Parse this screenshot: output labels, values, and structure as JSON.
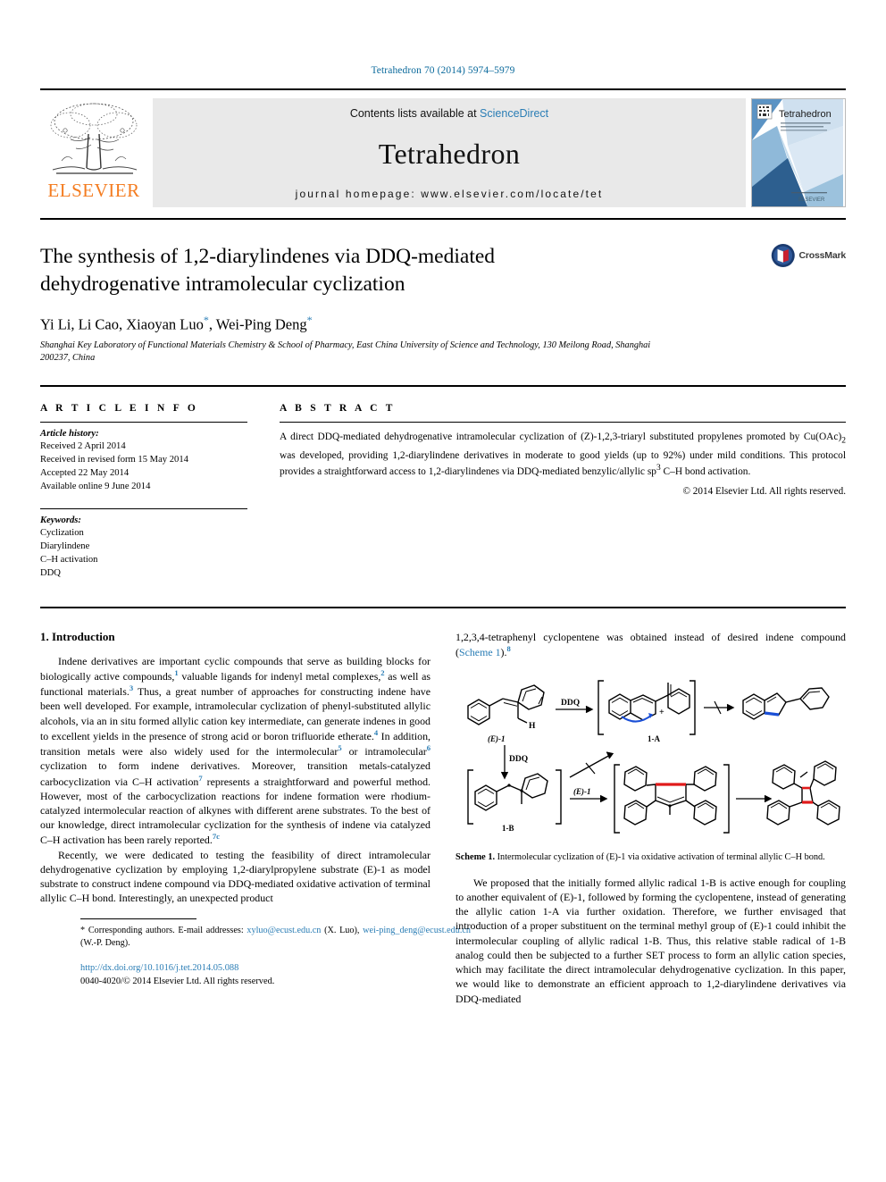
{
  "running_head": "Tetrahedron 70 (2014) 5974–5979",
  "masthead": {
    "contents_prefix": "Contents lists available at ",
    "sciencedirect": "ScienceDirect",
    "journal_name": "Tetrahedron",
    "homepage": "journal homepage: www.elsevier.com/locate/tet",
    "publisher_wordmark": "ELSEVIER",
    "cover_title": "Tetrahedron",
    "link_color": "#2a7db5",
    "elsevier_orange": "#F47C20"
  },
  "article": {
    "title": "The synthesis of 1,2-diarylindenes via DDQ-mediated dehydrogenative intramolecular cyclization",
    "authors": "Yi Li, Li Cao, Xiaoyan Luo",
    "authors_tail": ", Wei-Ping Deng",
    "affiliation": "Shanghai Key Laboratory of Functional Materials Chemistry & School of Pharmacy, East China University of Science and Technology, 130 Meilong Road, Shanghai 200237, China",
    "crossmark_label": "CrossMark"
  },
  "article_info": {
    "heading": "A R T I C L E   I N F O",
    "history_label": "Article history:",
    "history": [
      "Received 2 April 2014",
      "Received in revised form 15 May 2014",
      "Accepted 22 May 2014",
      "Available online 9 June 2014"
    ],
    "keywords_label": "Keywords:",
    "keywords": [
      "Cyclization",
      "Diarylindene",
      "C–H activation",
      "DDQ"
    ]
  },
  "abstract": {
    "heading": "A B S T R A C T",
    "text_part1": "A direct DDQ-mediated dehydrogenative intramolecular cyclization of (Z)-1,2,3-triaryl substituted propylenes promoted by Cu(OAc)",
    "sub1": "2",
    "text_part2": " was developed, providing 1,2-diarylindene derivatives in moderate to good yields (up to 92%) under mild conditions. This protocol provides a straightforward access to 1,2-diarylindenes via DDQ-mediated benzylic/allylic sp",
    "sup1": "3",
    "text_part3": " C–H bond activation.",
    "copyright": "© 2014 Elsevier Ltd. All rights reserved."
  },
  "body": {
    "intro_heading": "1. Introduction",
    "para1_a": "Indene derivatives are important cyclic compounds that serve as building blocks for biologically active compounds,",
    "ref1": "1",
    "para1_b": " valuable ligands for indenyl metal complexes,",
    "ref2": "2",
    "para1_c": " as well as functional materials.",
    "ref3": "3",
    "para1_d": " Thus, a great number of approaches for constructing indene have been well developed. For example, intramolecular cyclization of phenyl-substituted allylic alcohols, via an in situ formed allylic cation key intermediate, can generate indenes in good to excellent yields in the presence of strong acid or boron trifluoride etherate.",
    "ref4": "4",
    "para1_e": " In addition, transition metals were also widely used for the intermolecular",
    "ref5": "5",
    "para1_f": " or intramolecular",
    "ref6": "6",
    "para1_g": " cyclization to form indene derivatives. Moreover, transition metals-catalyzed carbocyclization via C–H activation",
    "ref7": "7",
    "para1_h": " represents a straightforward and powerful method. However, most of the carbocyclization reactions for indene formation were rhodium-catalyzed intermolecular reaction of alkynes with different arene substrates. To the best of our knowledge, direct intramolecular cyclization for the synthesis of indene via catalyzed C–H activation has been rarely reported.",
    "ref7c": "7c",
    "para2_a": "Recently, we were dedicated to testing the feasibility of direct intramolecular dehydrogenative cyclization by employing 1,2-diarylpropylene substrate (E)-1 as model substrate to construct indene compound via DDQ-mediated oxidative activation of terminal allylic C–H bond. Interestingly, an unexpected product",
    "right_lead_a": "1,2,3,4-tetraphenyl cyclopentene was obtained instead of desired indene compound (",
    "scheme_link": "Scheme 1",
    "right_lead_b": ").",
    "ref8": "8",
    "scheme_caption_label": "Scheme 1.",
    "scheme_caption_text": " Intermolecular cyclization of (E)-1 via oxidative activation of terminal allylic C–H bond.",
    "para3": "We proposed that the initially formed allylic radical 1-B is active enough for coupling to another equivalent of (E)-1, followed by forming the cyclopentene, instead of generating the allylic cation 1-A via further oxidation. Therefore, we further envisaged that introduction of a proper substituent on the terminal methyl group of (E)-1 could inhibit the intermolecular coupling of allylic radical 1-B. Thus, this relative stable radical of 1-B analog could then be subjected to a further SET process to form an allylic cation species, which may facilitate the direct intramolecular dehydrogenative cyclization. In this paper, we would like to demonstrate an efficient approach to 1,2-diarylindene derivatives via DDQ-mediated"
  },
  "scheme_labels": {
    "ddq1": "DDQ",
    "ddq2": "DDQ",
    "e1_label_a": "(E)-1",
    "e1_label_b": "(E)-1",
    "h_label": "H",
    "label_1a": "1-A",
    "label_1b": "1-B",
    "plus": "+"
  },
  "footnote": {
    "star": "*",
    "text_a": " Corresponding authors. E-mail addresses: ",
    "email1": "xyluo@ecust.edu.cn",
    "mid1": " (X. Luo), ",
    "email2": "wei-ping_deng@ecust.edu.cn",
    "mid2": " (W.-P. Deng).",
    "doi": "http://dx.doi.org/10.1016/j.tet.2014.05.088",
    "issn_line": "0040-4020/© 2014 Elsevier Ltd. All rights reserved."
  }
}
